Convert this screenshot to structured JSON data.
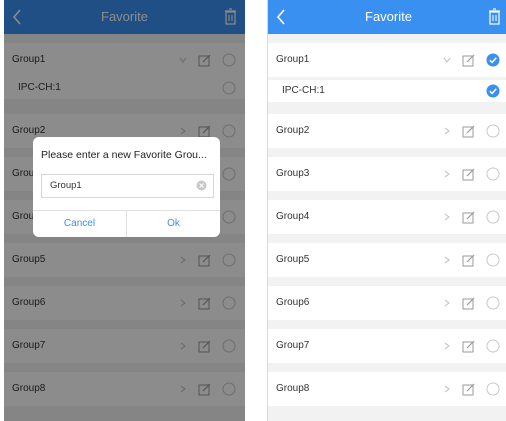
{
  "left_screen": {
    "nav": {
      "title": "Favorite",
      "back_icon": "chevron-left-icon",
      "trash_icon": "trash-icon"
    },
    "rows": [
      {
        "label": "Group1",
        "chevron": "chevron-down-icon",
        "checked": false
      },
      {
        "label": "IPC-CH:1",
        "child": true,
        "checked": false
      },
      {
        "label": "Group2",
        "chevron": "chevron-right-icon",
        "checked": false
      },
      {
        "label": "Grou",
        "chevron": "chevron-right-icon",
        "checked": false
      },
      {
        "label": "Grou",
        "chevron": "chevron-right-icon",
        "checked": false
      },
      {
        "label": "Group5",
        "chevron": "chevron-right-icon",
        "checked": false
      },
      {
        "label": "Group6",
        "chevron": "chevron-right-icon",
        "checked": false
      },
      {
        "label": "Group7",
        "chevron": "chevron-right-icon",
        "checked": false
      },
      {
        "label": "Group8",
        "chevron": "chevron-right-icon",
        "checked": false
      }
    ],
    "dialog": {
      "title": "Please enter a new Favorite Grou...",
      "input_value": "Group1",
      "cancel_label": "Cancel",
      "ok_label": "Ok"
    }
  },
  "right_screen": {
    "nav": {
      "title": "Favorite",
      "back_icon": "chevron-left-icon",
      "trash_icon": "trash-icon"
    },
    "rows": [
      {
        "label": "Group1",
        "chevron": "chevron-down-icon",
        "checked": true
      },
      {
        "label": "IPC-CH:1",
        "child": true,
        "checked": true
      },
      {
        "label": "Group2",
        "chevron": "chevron-right-icon",
        "checked": false
      },
      {
        "label": "Group3",
        "chevron": "chevron-right-icon",
        "checked": false
      },
      {
        "label": "Group4",
        "chevron": "chevron-right-icon",
        "checked": false
      },
      {
        "label": "Group5",
        "chevron": "chevron-right-icon",
        "checked": false
      },
      {
        "label": "Group6",
        "chevron": "chevron-right-icon",
        "checked": false
      },
      {
        "label": "Group7",
        "chevron": "chevron-right-icon",
        "checked": false
      },
      {
        "label": "Group8",
        "chevron": "chevron-right-icon",
        "checked": false
      }
    ]
  },
  "colors": {
    "accent": "#3a90f0",
    "row_bg": "#ffffff",
    "list_bg": "#f2f2f2",
    "overlay": "rgba(0,0,0,0.45)"
  }
}
